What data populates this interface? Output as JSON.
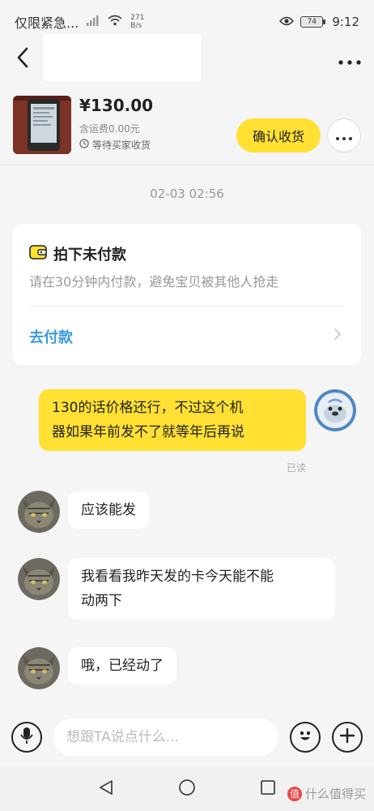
{
  "status_bar": {
    "carrier": "仅限紧急...",
    "net_speed_value": "271",
    "net_speed_unit": "B/s",
    "battery": "74",
    "time": "9:12"
  },
  "header": {
    "back_icon": "chevron-left-icon",
    "more_icon": "more-horizontal-icon"
  },
  "product": {
    "price": "¥130.00",
    "shipping": "含运费0.00元",
    "status": "等待买家收货",
    "confirm_label": "确认收货"
  },
  "chat": {
    "timestamp": "02-03 02:56",
    "pay_card": {
      "title": "拍下未付款",
      "description": "请在30分钟内付款，避免宝贝被其他人抢走",
      "action": "去付款"
    },
    "messages": [
      {
        "side": "right",
        "text_line1": "130的话价格还行，不过这个机",
        "text_line2": "器如果年前发不了就等年后再说",
        "read": "已读"
      },
      {
        "side": "left",
        "text_line1": "应该能发"
      },
      {
        "side": "left",
        "text_line1": "我看看我昨天发的卡今天能不能",
        "text_line2": "动两下"
      },
      {
        "side": "left",
        "text_line1": "哦，已经动了"
      }
    ]
  },
  "input_bar": {
    "placeholder": "想跟TA说点什么..."
  },
  "watermark": "什么值得买",
  "colors": {
    "accent_yellow": "#ffe033",
    "link_blue": "#3a9ad9",
    "background": "#f5f5f5"
  }
}
